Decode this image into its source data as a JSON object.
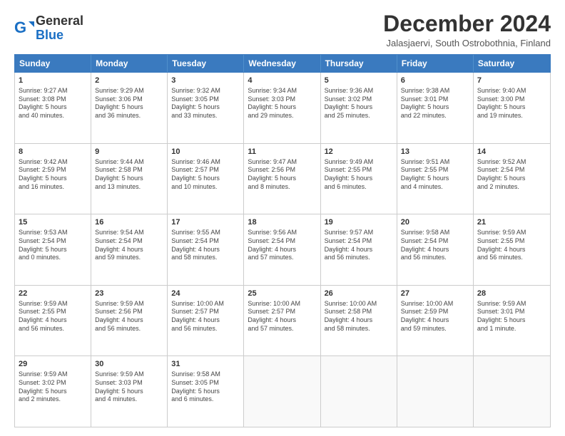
{
  "header": {
    "logo_general": "General",
    "logo_blue": "Blue",
    "month_title": "December 2024",
    "subtitle": "Jalasjaervi, South Ostrobothnia, Finland"
  },
  "weekdays": [
    "Sunday",
    "Monday",
    "Tuesday",
    "Wednesday",
    "Thursday",
    "Friday",
    "Saturday"
  ],
  "rows": [
    [
      {
        "day": "1",
        "lines": [
          "Sunrise: 9:27 AM",
          "Sunset: 3:08 PM",
          "Daylight: 5 hours",
          "and 40 minutes."
        ]
      },
      {
        "day": "2",
        "lines": [
          "Sunrise: 9:29 AM",
          "Sunset: 3:06 PM",
          "Daylight: 5 hours",
          "and 36 minutes."
        ]
      },
      {
        "day": "3",
        "lines": [
          "Sunrise: 9:32 AM",
          "Sunset: 3:05 PM",
          "Daylight: 5 hours",
          "and 33 minutes."
        ]
      },
      {
        "day": "4",
        "lines": [
          "Sunrise: 9:34 AM",
          "Sunset: 3:03 PM",
          "Daylight: 5 hours",
          "and 29 minutes."
        ]
      },
      {
        "day": "5",
        "lines": [
          "Sunrise: 9:36 AM",
          "Sunset: 3:02 PM",
          "Daylight: 5 hours",
          "and 25 minutes."
        ]
      },
      {
        "day": "6",
        "lines": [
          "Sunrise: 9:38 AM",
          "Sunset: 3:01 PM",
          "Daylight: 5 hours",
          "and 22 minutes."
        ]
      },
      {
        "day": "7",
        "lines": [
          "Sunrise: 9:40 AM",
          "Sunset: 3:00 PM",
          "Daylight: 5 hours",
          "and 19 minutes."
        ]
      }
    ],
    [
      {
        "day": "8",
        "lines": [
          "Sunrise: 9:42 AM",
          "Sunset: 2:59 PM",
          "Daylight: 5 hours",
          "and 16 minutes."
        ]
      },
      {
        "day": "9",
        "lines": [
          "Sunrise: 9:44 AM",
          "Sunset: 2:58 PM",
          "Daylight: 5 hours",
          "and 13 minutes."
        ]
      },
      {
        "day": "10",
        "lines": [
          "Sunrise: 9:46 AM",
          "Sunset: 2:57 PM",
          "Daylight: 5 hours",
          "and 10 minutes."
        ]
      },
      {
        "day": "11",
        "lines": [
          "Sunrise: 9:47 AM",
          "Sunset: 2:56 PM",
          "Daylight: 5 hours",
          "and 8 minutes."
        ]
      },
      {
        "day": "12",
        "lines": [
          "Sunrise: 9:49 AM",
          "Sunset: 2:55 PM",
          "Daylight: 5 hours",
          "and 6 minutes."
        ]
      },
      {
        "day": "13",
        "lines": [
          "Sunrise: 9:51 AM",
          "Sunset: 2:55 PM",
          "Daylight: 5 hours",
          "and 4 minutes."
        ]
      },
      {
        "day": "14",
        "lines": [
          "Sunrise: 9:52 AM",
          "Sunset: 2:54 PM",
          "Daylight: 5 hours",
          "and 2 minutes."
        ]
      }
    ],
    [
      {
        "day": "15",
        "lines": [
          "Sunrise: 9:53 AM",
          "Sunset: 2:54 PM",
          "Daylight: 5 hours",
          "and 0 minutes."
        ]
      },
      {
        "day": "16",
        "lines": [
          "Sunrise: 9:54 AM",
          "Sunset: 2:54 PM",
          "Daylight: 4 hours",
          "and 59 minutes."
        ]
      },
      {
        "day": "17",
        "lines": [
          "Sunrise: 9:55 AM",
          "Sunset: 2:54 PM",
          "Daylight: 4 hours",
          "and 58 minutes."
        ]
      },
      {
        "day": "18",
        "lines": [
          "Sunrise: 9:56 AM",
          "Sunset: 2:54 PM",
          "Daylight: 4 hours",
          "and 57 minutes."
        ]
      },
      {
        "day": "19",
        "lines": [
          "Sunrise: 9:57 AM",
          "Sunset: 2:54 PM",
          "Daylight: 4 hours",
          "and 56 minutes."
        ]
      },
      {
        "day": "20",
        "lines": [
          "Sunrise: 9:58 AM",
          "Sunset: 2:54 PM",
          "Daylight: 4 hours",
          "and 56 minutes."
        ]
      },
      {
        "day": "21",
        "lines": [
          "Sunrise: 9:59 AM",
          "Sunset: 2:55 PM",
          "Daylight: 4 hours",
          "and 56 minutes."
        ]
      }
    ],
    [
      {
        "day": "22",
        "lines": [
          "Sunrise: 9:59 AM",
          "Sunset: 2:55 PM",
          "Daylight: 4 hours",
          "and 56 minutes."
        ]
      },
      {
        "day": "23",
        "lines": [
          "Sunrise: 9:59 AM",
          "Sunset: 2:56 PM",
          "Daylight: 4 hours",
          "and 56 minutes."
        ]
      },
      {
        "day": "24",
        "lines": [
          "Sunrise: 10:00 AM",
          "Sunset: 2:57 PM",
          "Daylight: 4 hours",
          "and 56 minutes."
        ]
      },
      {
        "day": "25",
        "lines": [
          "Sunrise: 10:00 AM",
          "Sunset: 2:57 PM",
          "Daylight: 4 hours",
          "and 57 minutes."
        ]
      },
      {
        "day": "26",
        "lines": [
          "Sunrise: 10:00 AM",
          "Sunset: 2:58 PM",
          "Daylight: 4 hours",
          "and 58 minutes."
        ]
      },
      {
        "day": "27",
        "lines": [
          "Sunrise: 10:00 AM",
          "Sunset: 2:59 PM",
          "Daylight: 4 hours",
          "and 59 minutes."
        ]
      },
      {
        "day": "28",
        "lines": [
          "Sunrise: 9:59 AM",
          "Sunset: 3:01 PM",
          "Daylight: 5 hours",
          "and 1 minute."
        ]
      }
    ],
    [
      {
        "day": "29",
        "lines": [
          "Sunrise: 9:59 AM",
          "Sunset: 3:02 PM",
          "Daylight: 5 hours",
          "and 2 minutes."
        ]
      },
      {
        "day": "30",
        "lines": [
          "Sunrise: 9:59 AM",
          "Sunset: 3:03 PM",
          "Daylight: 5 hours",
          "and 4 minutes."
        ]
      },
      {
        "day": "31",
        "lines": [
          "Sunrise: 9:58 AM",
          "Sunset: 3:05 PM",
          "Daylight: 5 hours",
          "and 6 minutes."
        ]
      },
      null,
      null,
      null,
      null
    ]
  ]
}
